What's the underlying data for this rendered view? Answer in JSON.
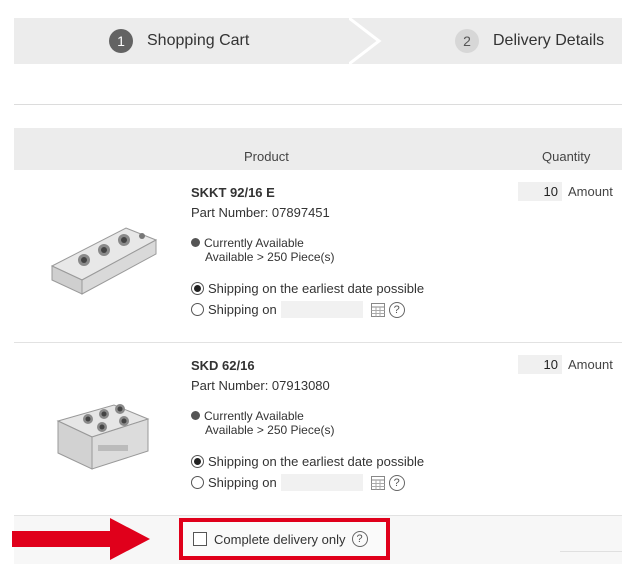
{
  "steps": [
    {
      "num": "1",
      "label": "Shopping Cart"
    },
    {
      "num": "2",
      "label": "Delivery Details"
    }
  ],
  "table": {
    "col_product": "Product",
    "col_quantity": "Quantity"
  },
  "products": [
    {
      "name": "SKKT 92/16 E",
      "part_number": "Part Number: 07897451",
      "availability": "Currently Available",
      "availability_sub": "Available > 250 Piece(s)",
      "ship_earliest": "Shipping on the earliest date possible",
      "ship_on": "Shipping on",
      "quantity": "10",
      "unit": "Amount"
    },
    {
      "name": "SKD 62/16",
      "part_number": "Part Number: 07913080",
      "availability": "Currently Available",
      "availability_sub": "Available > 250 Piece(s)",
      "ship_earliest": "Shipping on the earliest date possible",
      "ship_on": "Shipping on",
      "quantity": "10",
      "unit": "Amount"
    }
  ],
  "footer": {
    "complete_delivery": "Complete delivery only"
  },
  "icons": {
    "help": "?",
    "calendar": "calendar-icon",
    "arrow": "arrow-right-icon"
  },
  "colors": {
    "accent": "#e0001b",
    "active_step": "#636363",
    "band": "#ececec"
  }
}
